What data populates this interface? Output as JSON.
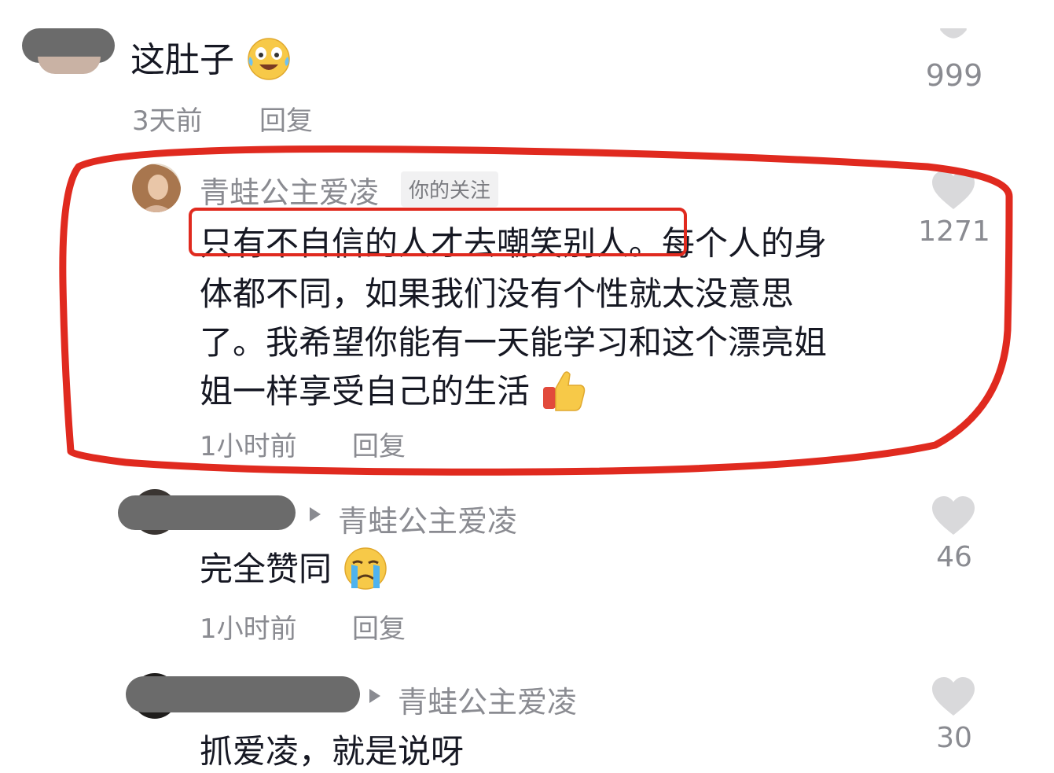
{
  "comments": [
    {
      "text": "这肚子",
      "emoji": "laughing-crying-emoji",
      "time": "3天前",
      "reply_label": "回复",
      "likes": "999"
    },
    {
      "username": "青蛙公主爱凌",
      "tag": "你的关注",
      "text_line1": "只有不自信的人才去嘲笑别人。每个人的身",
      "text_highlight": "只有不自信的人才去嘲笑别人。",
      "text_line1_rest": "每个人的身",
      "text_line2": "体都不同，如果我们没有个性就太没意思",
      "text_line3": "了。我希望你能有一天能学习和这个漂亮姐",
      "text_line4": "姐一样享受自己的生活",
      "emoji": "thumbs-up-emoji",
      "time": "1小时前",
      "reply_label": "回复",
      "likes": "1271"
    },
    {
      "reply_to": "青蛙公主爱凌",
      "text": "完全赞同",
      "emoji": "crying-emoji",
      "time": "1小时前",
      "reply_label": "回复",
      "likes": "46"
    },
    {
      "reply_to": "青蛙公主爱凌",
      "text": "抓爱凌，就是说呀",
      "likes": "30"
    }
  ],
  "colors": {
    "annotation_red": "#e02a1f",
    "heart_gray": "#d9d9db",
    "meta_gray": "#8a8b91",
    "text_dark": "#161823"
  }
}
